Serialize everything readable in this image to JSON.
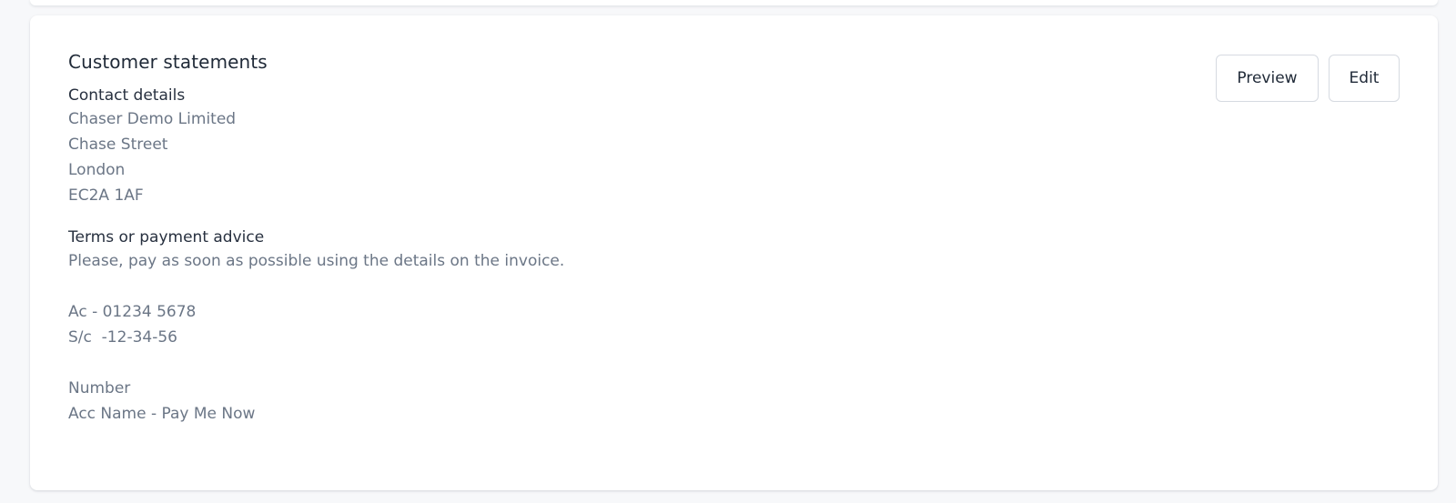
{
  "card": {
    "title": "Customer statements",
    "actions": {
      "preview_label": "Preview",
      "edit_label": "Edit"
    },
    "contact": {
      "label": "Contact details",
      "lines": [
        "Chaser Demo Limited",
        "Chase Street",
        "London",
        "EC2A 1AF"
      ]
    },
    "terms": {
      "label": "Terms or payment advice",
      "lines": [
        "Please, pay as soon as possible using the details on the invoice.",
        "",
        "Ac - 01234 5678",
        "S/c  -12-34-56",
        "",
        "Number",
        "Acc Name - Pay Me Now"
      ]
    }
  }
}
